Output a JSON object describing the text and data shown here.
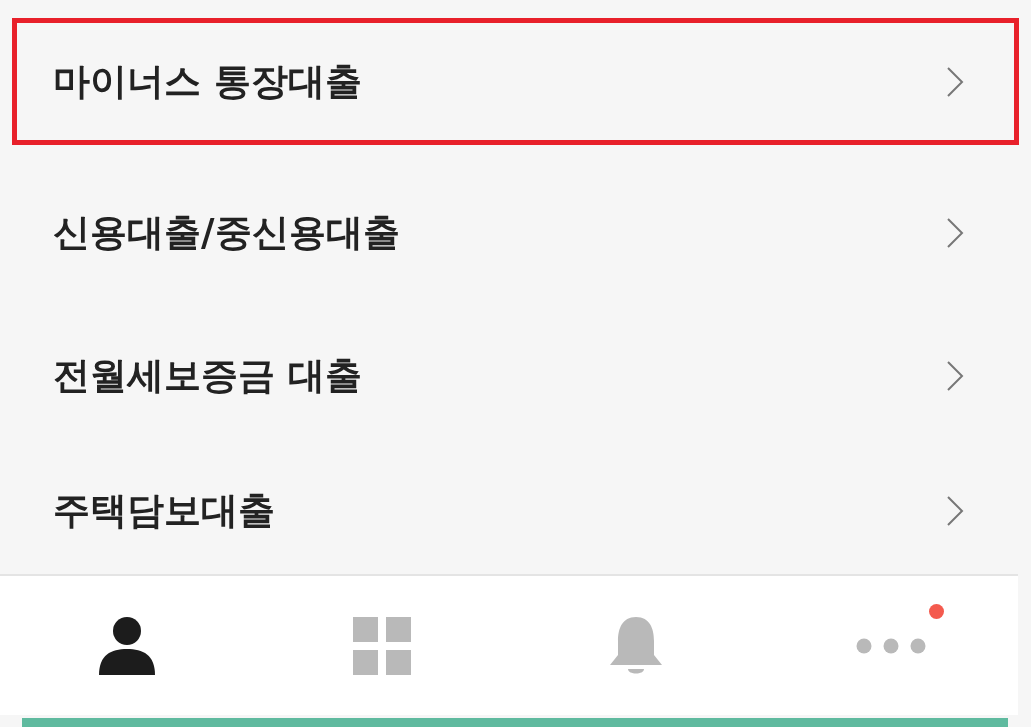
{
  "menu": {
    "items": [
      {
        "label": "마이너스 통장대출",
        "highlighted": true
      },
      {
        "label": "신용대출/중신용대출",
        "highlighted": false
      },
      {
        "label": "전월세보증금 대출",
        "highlighted": false
      },
      {
        "label": "주택담보대출",
        "highlighted": false
      }
    ]
  },
  "tab_bar": {
    "tabs": [
      {
        "kind": "profile",
        "selected": true,
        "badge": false
      },
      {
        "kind": "grid",
        "selected": false,
        "badge": false
      },
      {
        "kind": "bell",
        "selected": false,
        "badge": false
      },
      {
        "kind": "more",
        "selected": false,
        "badge": true
      }
    ]
  }
}
